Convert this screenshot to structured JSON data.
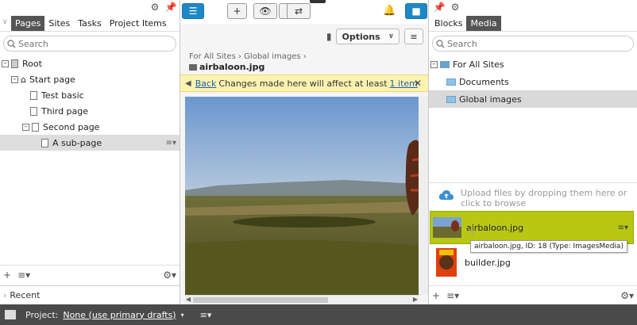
{
  "left": {
    "tabs": [
      "Pages",
      "Sites",
      "Tasks",
      "Project Items"
    ],
    "search_placeholder": "Search",
    "tree": [
      {
        "label": "Root"
      },
      {
        "label": "Start page"
      },
      {
        "label": "Test basic"
      },
      {
        "label": "Third page"
      },
      {
        "label": "Second page"
      },
      {
        "label": "A sub-page"
      }
    ],
    "recent_label": "Recent"
  },
  "center": {
    "options_label": "Options",
    "breadcrumb": [
      "For All Sites",
      "Global images"
    ],
    "title": "airbaloon.jpg",
    "notice": {
      "back_label": "Back",
      "text": "Changes made here will affect at least",
      "link": "1 item"
    }
  },
  "right": {
    "tabs": [
      "Blocks",
      "Media"
    ],
    "search_placeholder": "Search",
    "folders": [
      {
        "label": "For All Sites"
      },
      {
        "label": "Documents"
      },
      {
        "label": "Global images"
      }
    ],
    "upload_text": "Upload files by dropping them here or click to browse",
    "media": [
      {
        "name": "airbaloon.jpg"
      },
      {
        "name": "builder.jpg"
      }
    ],
    "tooltip": "airbaloon.jpg, ID: 18 (Type: ImagesMedia)"
  },
  "statusbar": {
    "project_label": "Project:",
    "project_value": "None (use primary drafts)"
  },
  "colors": {
    "accent": "#1e88c7",
    "selected_media": "#b8c812",
    "notice_bg": "#fdf3b1",
    "statusbar": "#4a4a4a"
  }
}
